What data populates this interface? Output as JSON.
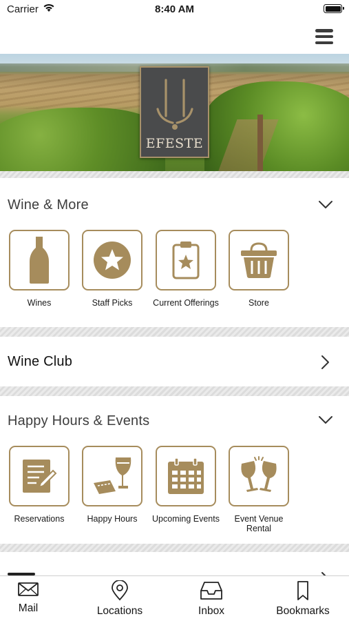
{
  "status_bar": {
    "carrier": "Carrier",
    "time": "8:40 AM"
  },
  "logo": {
    "brand": "EFESTE"
  },
  "sections": [
    {
      "title": "Wine & More",
      "tiles": [
        {
          "label": "Wines",
          "icon": "wine-bottle-icon"
        },
        {
          "label": "Staff Picks",
          "icon": "star-icon"
        },
        {
          "label": "Current Offerings",
          "icon": "clipboard-star-icon"
        },
        {
          "label": "Store",
          "icon": "basket-icon"
        }
      ]
    },
    {
      "title": "Wine Club"
    },
    {
      "title": "Happy Hours & Events",
      "tiles": [
        {
          "label": "Reservations",
          "icon": "notepad-pencil-icon"
        },
        {
          "label": "Happy Hours",
          "icon": "wine-glass-ticket-icon"
        },
        {
          "label": "Upcoming Events",
          "icon": "calendar-icon"
        },
        {
          "label": "Event Venue Rental",
          "icon": "toast-glasses-icon"
        }
      ]
    }
  ],
  "tab_bar": {
    "tabs": [
      {
        "label": "Mail",
        "icon": "mail-icon"
      },
      {
        "label": "Locations",
        "icon": "location-pin-icon"
      },
      {
        "label": "Inbox",
        "icon": "inbox-icon"
      },
      {
        "label": "Bookmarks",
        "icon": "bookmark-icon"
      }
    ]
  },
  "colors": {
    "accent": "#a68c5c",
    "icon_fill": "#a68c5c",
    "text": "#1a1a1a"
  }
}
